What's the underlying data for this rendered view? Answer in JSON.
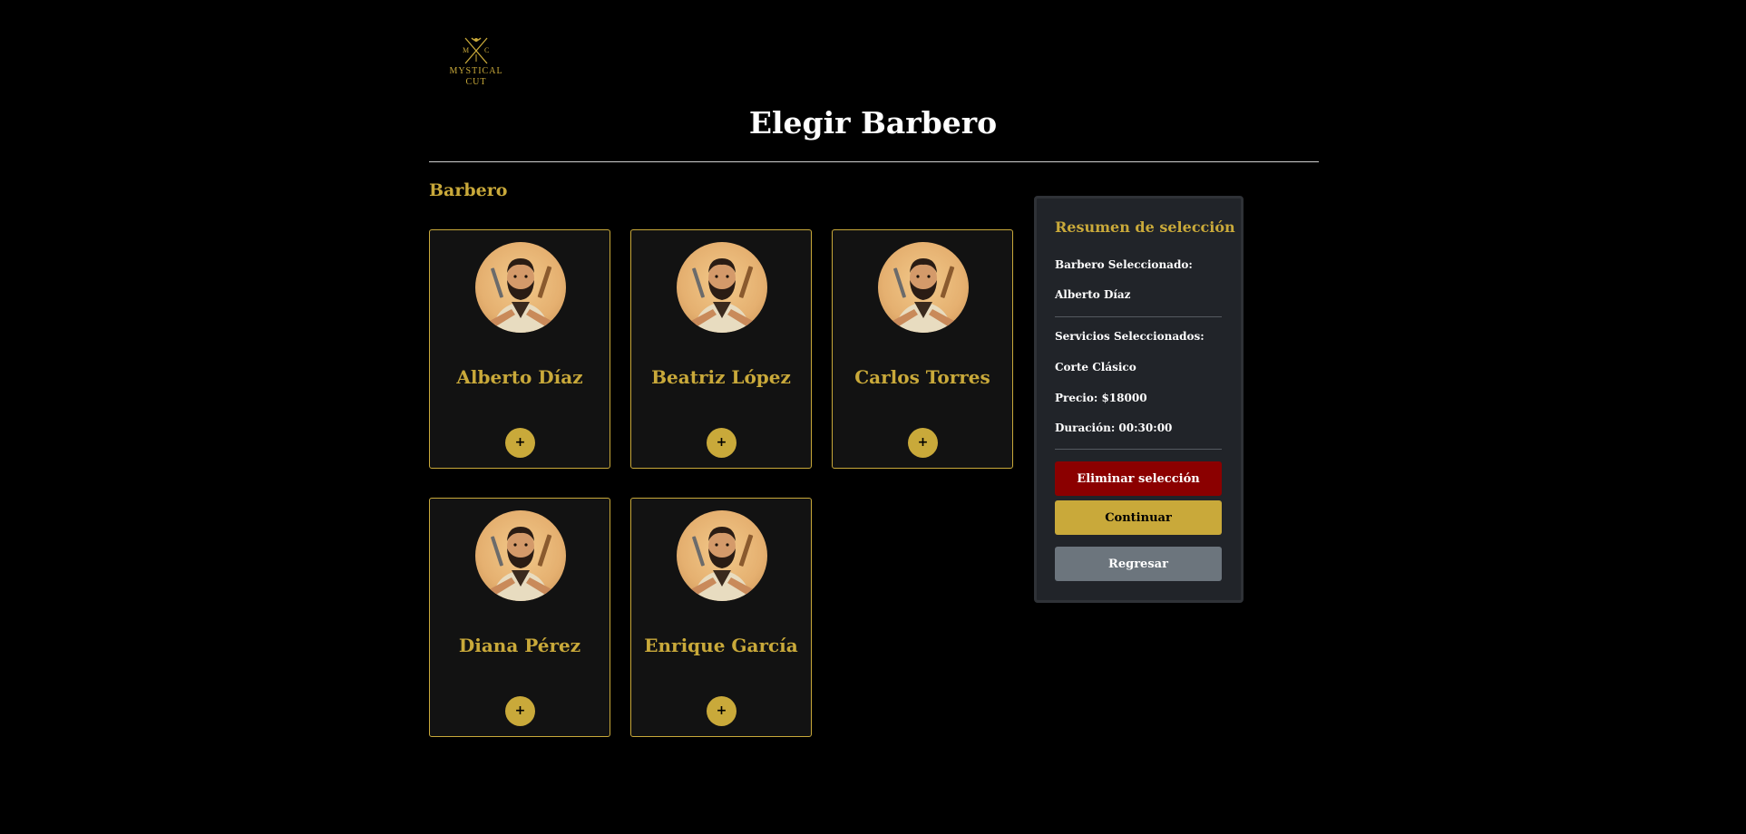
{
  "logo": {
    "top_letters": "M C",
    "text_line1": "MYSTICAL",
    "text_line2": "CUT"
  },
  "page": {
    "title": "Elegir Barbero",
    "section_label": "Barbero"
  },
  "barbers": [
    {
      "name": "Alberto Díaz",
      "add_label": "+"
    },
    {
      "name": "Beatriz López",
      "add_label": "+"
    },
    {
      "name": "Carlos Torres",
      "add_label": "+"
    },
    {
      "name": "Diana Pérez",
      "add_label": "+"
    },
    {
      "name": "Enrique García",
      "add_label": "+"
    }
  ],
  "summary": {
    "title": "Resumen de selección",
    "barber_heading": "Barbero Seleccionado:",
    "barber_value": "Alberto Díaz",
    "services_heading": "Servicios Seleccionados:",
    "service_name": "Corte Clásico",
    "price": "Precio: $18000",
    "duration": "Duración: 00:30:00",
    "delete_label": "Eliminar selección",
    "continue_label": "Continuar",
    "back_label": "Regresar"
  },
  "colors": {
    "accent": "#c9a93a",
    "danger": "#8b0000",
    "secondary": "#6c757d",
    "panel": "#212429",
    "card": "#121212"
  },
  "icons": {
    "logo": "crossed-scissors-razor-logo",
    "avatar": "barber-portrait"
  }
}
